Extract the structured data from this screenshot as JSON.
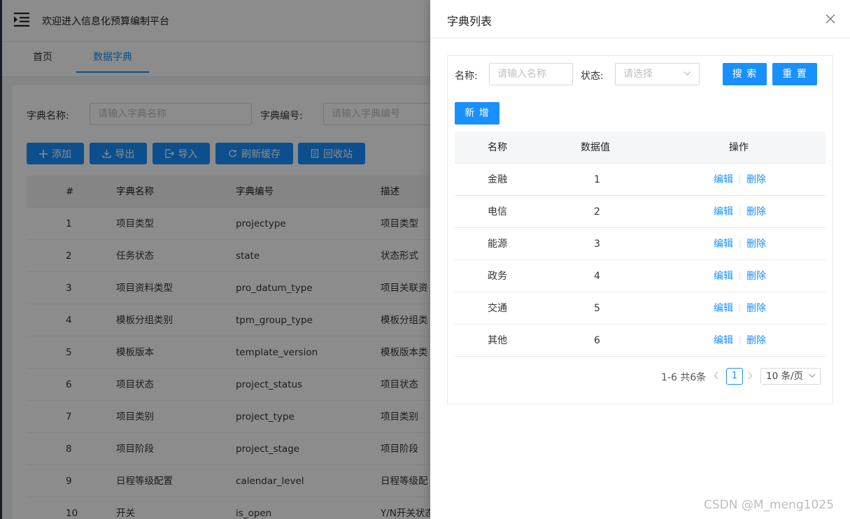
{
  "app": {
    "title": "欢迎进入信息化预算编制平台",
    "tabs": [
      "首页",
      "数据字典"
    ]
  },
  "filters": {
    "name_label": "字典名称:",
    "name_placeholder": "请输入字典名称",
    "code_label": "字典编号:",
    "code_placeholder": "请输入字典编号"
  },
  "toolbar": {
    "add": "添加",
    "export": "导出",
    "import": "导入",
    "refresh_cache": "刷新缓存",
    "recycle_bin": "回收站"
  },
  "dict_table": {
    "columns": [
      "#",
      "字典名称",
      "字典编号",
      "描述"
    ],
    "rows": [
      [
        "1",
        "项目类型",
        "projectype",
        "项目类型"
      ],
      [
        "2",
        "任务状态",
        "state",
        "状态形式"
      ],
      [
        "3",
        "项目资料类型",
        "pro_datum_type",
        "项目关联资"
      ],
      [
        "4",
        "模板分组类别",
        "tpm_group_type",
        "模板分组类"
      ],
      [
        "5",
        "模板版本",
        "template_version",
        "模板版本类"
      ],
      [
        "6",
        "项目状态",
        "project_status",
        "项目状态"
      ],
      [
        "7",
        "项目类别",
        "project_type",
        "项目类别"
      ],
      [
        "8",
        "项目阶段",
        "project_stage",
        "项目阶段"
      ],
      [
        "9",
        "日程等级配置",
        "calendar_level",
        "日程等级配"
      ],
      [
        "10",
        "开关",
        "is_open",
        "Y/N开关状态"
      ]
    ]
  },
  "drawer": {
    "title": "字典列表",
    "name_label": "名称:",
    "name_placeholder": "请输入名称",
    "status_label": "状态:",
    "status_placeholder": "请选择",
    "search_button": "搜 索",
    "reset_button": "重 置",
    "add_button": "新 增",
    "columns": [
      "名称",
      "数据值",
      "操作"
    ],
    "edit_label": "编辑",
    "delete_label": "删除",
    "rows": [
      [
        "金融",
        "1"
      ],
      [
        "电信",
        "2"
      ],
      [
        "能源",
        "3"
      ],
      [
        "政务",
        "4"
      ],
      [
        "交通",
        "5"
      ],
      [
        "其他",
        "6"
      ]
    ],
    "pagination": {
      "total_text": "1-6 共6条",
      "current_page": "1",
      "page_size": "10 条/页"
    }
  },
  "watermark": "CSDN @M_meng1025",
  "colors": {
    "primary": "#1890ff",
    "overlay": "rgba(0,0,0,0.45)"
  }
}
